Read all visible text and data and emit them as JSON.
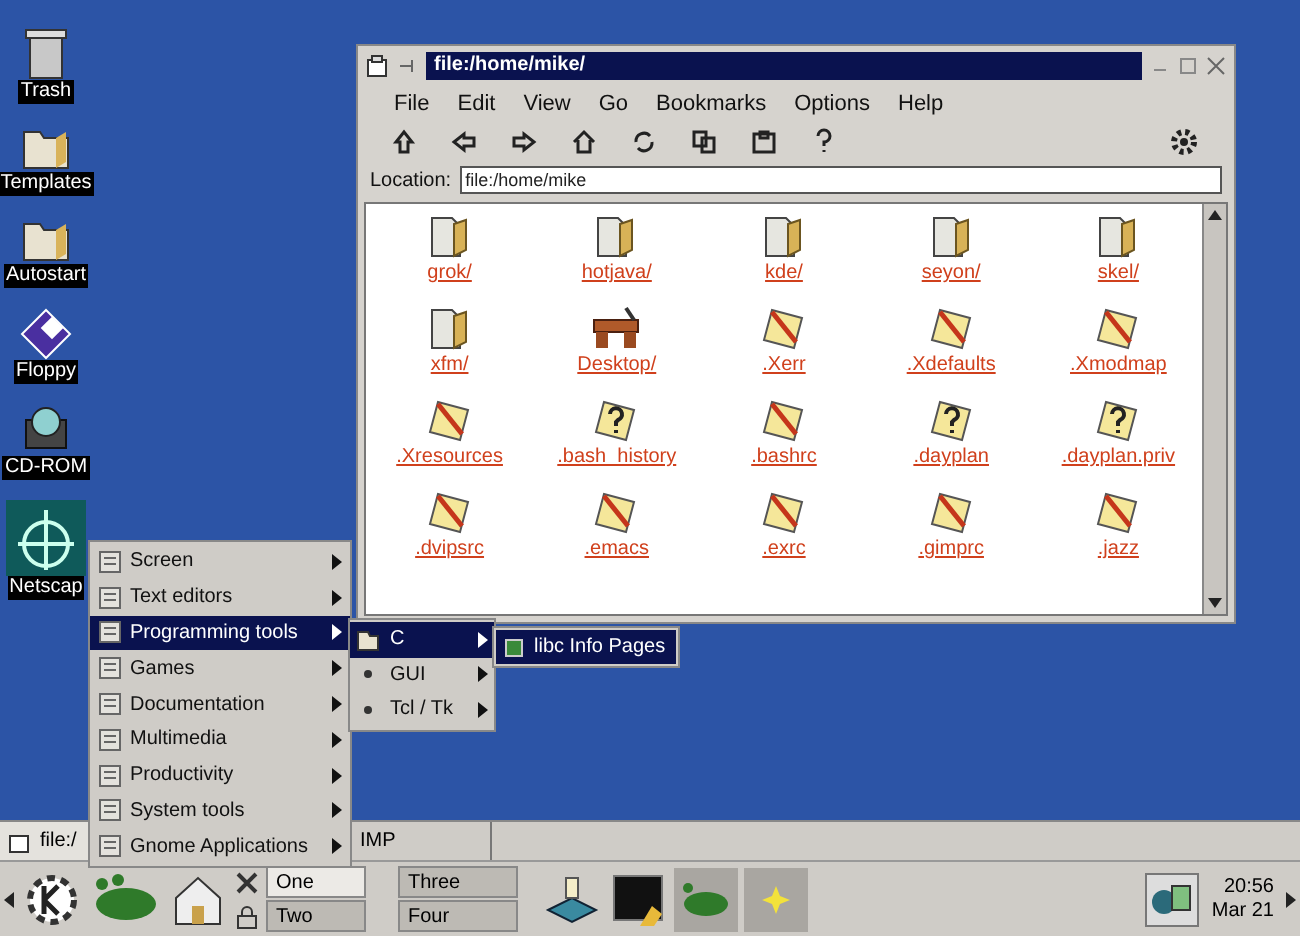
{
  "desktop_icons": [
    {
      "label": "Trash",
      "kind": "trash"
    },
    {
      "label": "Templates",
      "kind": "folder"
    },
    {
      "label": "Autostart",
      "kind": "folder"
    },
    {
      "label": "Floppy",
      "kind": "floppy"
    },
    {
      "label": "CD-ROM",
      "kind": "cdrom"
    },
    {
      "label": "Netscap",
      "kind": "wheel"
    }
  ],
  "window": {
    "title": "file:/home/mike/",
    "menu": [
      "File",
      "Edit",
      "View",
      "Go",
      "Bookmarks",
      "Options",
      "Help"
    ],
    "location": {
      "label": "Location:",
      "value": "file:/home/mike"
    },
    "files": [
      {
        "name": "grok/",
        "kind": "folder"
      },
      {
        "name": "hotjava/",
        "kind": "folder"
      },
      {
        "name": "kde/",
        "kind": "folder"
      },
      {
        "name": "seyon/",
        "kind": "folder"
      },
      {
        "name": "skel/",
        "kind": "folder"
      },
      {
        "name": "xfm/",
        "kind": "folder"
      },
      {
        "name": "Desktop/",
        "kind": "desk"
      },
      {
        "name": ".Xerr",
        "kind": "text"
      },
      {
        "name": ".Xdefaults",
        "kind": "text"
      },
      {
        "name": ".Xmodmap",
        "kind": "text"
      },
      {
        "name": ".Xresources",
        "kind": "text"
      },
      {
        "name": ".bash_history",
        "kind": "unknown"
      },
      {
        "name": ".bashrc",
        "kind": "text"
      },
      {
        "name": ".dayplan",
        "kind": "unknown"
      },
      {
        "name": ".dayplan.priv",
        "kind": "unknown"
      },
      {
        "name": ".dvipsrc",
        "kind": "text"
      },
      {
        "name": ".emacs",
        "kind": "text"
      },
      {
        "name": ".exrc",
        "kind": "text"
      },
      {
        "name": ".gimprc",
        "kind": "text"
      },
      {
        "name": ".jazz",
        "kind": "text"
      }
    ]
  },
  "tasks": [
    {
      "label": "file:/"
    },
    {
      "label": "IMP"
    }
  ],
  "start_menu": [
    {
      "label": "Screen",
      "selected": false
    },
    {
      "label": "Text editors",
      "selected": false
    },
    {
      "label": "Programming tools",
      "selected": true
    },
    {
      "label": "Games",
      "selected": false
    },
    {
      "label": "Documentation",
      "selected": false
    },
    {
      "label": "Multimedia",
      "selected": false
    },
    {
      "label": "Productivity",
      "selected": false
    },
    {
      "label": "System tools",
      "selected": false
    },
    {
      "label": "Gnome Applications",
      "selected": false
    }
  ],
  "submenu": [
    {
      "label": "C",
      "selected": true,
      "kind": "folder"
    },
    {
      "label": "GUI",
      "selected": false,
      "kind": "dot"
    },
    {
      "label": "Tcl / Tk",
      "selected": false,
      "kind": "dot"
    }
  ],
  "submenu_2": [
    {
      "label": "libc Info Pages",
      "selected": true
    }
  ],
  "pager": [
    {
      "label": "One",
      "selected": true
    },
    {
      "label": "Two",
      "selected": false
    },
    {
      "label": "Three",
      "selected": false
    },
    {
      "label": "Four",
      "selected": false
    }
  ],
  "clock": {
    "time": "20:56",
    "date": "Mar 21"
  }
}
